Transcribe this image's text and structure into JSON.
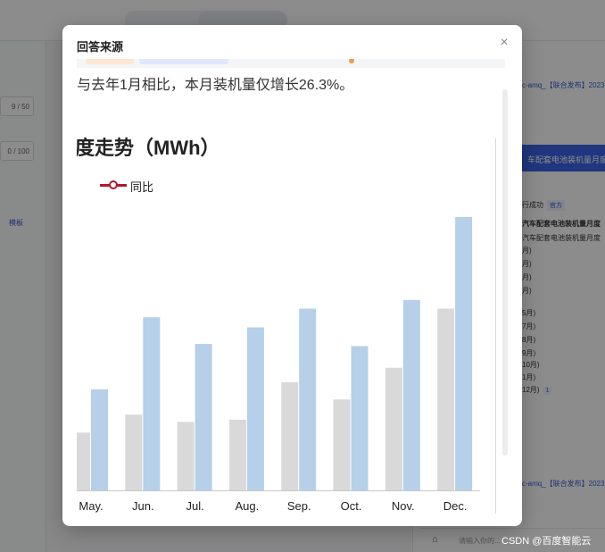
{
  "background": {
    "counters": [
      "9 / 50",
      "0 / 100"
    ],
    "template_label": "模板",
    "right_panel": {
      "link1": "c-amq_【联合发布】2023...",
      "blue_bar": "车配套电池装机量月度...",
      "status": "行成功",
      "status_tag": "官方",
      "heading": "汽车配套电池装机量月度",
      "subheading": "汽车配套电池装机量月度",
      "months": [
        "月)",
        "月)",
        "月)",
        "月)",
        "5月)",
        "7月)",
        "8月)",
        "9月)",
        "10月)",
        "1月)",
        "12月)"
      ],
      "last_badge": "1",
      "link2": "c-amq_【联合发布】2023..."
    },
    "bottom_input_placeholder": "请输入你的..."
  },
  "watermark": "CSDN @百度智能云",
  "modal": {
    "title": "回答来源",
    "close_label": "×",
    "article_text": "与去年1月相比，本月装机量仅增长26.3%。",
    "section_title": "度走势（MWh）",
    "legend_label": "同比"
  },
  "colors": {
    "current_year": "#b5d0e8",
    "prior_year": "#d9d9d9",
    "legend_line": "#b2182b"
  },
  "chart_data": {
    "type": "bar",
    "categories": [
      "May.",
      "Jun.",
      "Jul.",
      "Aug.",
      "Sep.",
      "Oct.",
      "Nov.",
      "Dec."
    ],
    "series": [
      {
        "values": [
          8,
          10.5,
          9.5,
          9.8,
          15,
          12.6,
          17,
          25.2
        ]
      },
      {
        "values": [
          14,
          24,
          20.3,
          22.6,
          25.2,
          20,
          26.4,
          37.9
        ]
      }
    ],
    "legend": [
      "同比"
    ],
    "ylim": [
      0,
      40
    ],
    "grid": false
  }
}
